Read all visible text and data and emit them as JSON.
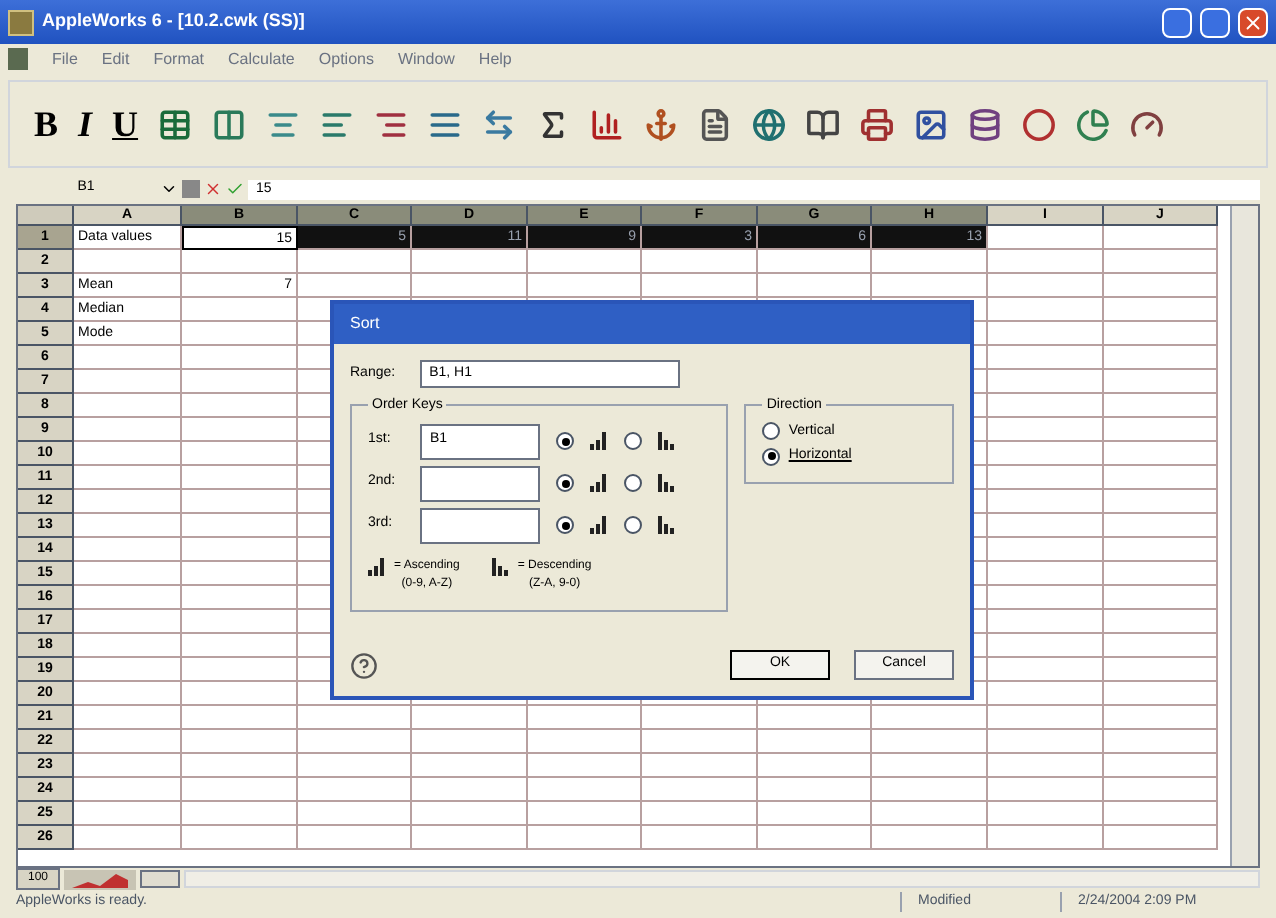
{
  "window": {
    "title": "AppleWorks 6 - [10.2.cwk (SS)]"
  },
  "menu": [
    "File",
    "Edit",
    "Format",
    "Calculate",
    "Options",
    "Window",
    "Help"
  ],
  "toolbar": {
    "text_buttons": [
      "B",
      "I",
      "U"
    ]
  },
  "formula_bar": {
    "cell_ref": "B1",
    "value": "15"
  },
  "columns": [
    {
      "label": "A",
      "selected": false
    },
    {
      "label": "B",
      "selected": true
    },
    {
      "label": "C",
      "selected": true
    },
    {
      "label": "D",
      "selected": true
    },
    {
      "label": "E",
      "selected": true
    },
    {
      "label": "F",
      "selected": true
    },
    {
      "label": "G",
      "selected": true
    },
    {
      "label": "H",
      "selected": true
    },
    {
      "label": "I",
      "selected": false
    },
    {
      "label": "J",
      "selected": false
    }
  ],
  "rows": [
    {
      "number": "1",
      "selected": true,
      "cells": [
        "Data values",
        "15",
        "5",
        "11",
        "9",
        "3",
        "6",
        "13"
      ]
    },
    {
      "number": "2",
      "selected": false,
      "cells": []
    },
    {
      "number": "3",
      "selected": false,
      "cells": [
        "Mean",
        "7"
      ]
    },
    {
      "number": "4",
      "selected": false,
      "cells": [
        "Median"
      ]
    },
    {
      "number": "5",
      "selected": false,
      "cells": [
        "Mode"
      ]
    },
    {
      "number": "6",
      "selected": false,
      "cells": []
    },
    {
      "number": "7",
      "selected": false,
      "cells": []
    },
    {
      "number": "8",
      "selected": false,
      "cells": []
    },
    {
      "number": "9",
      "selected": false,
      "cells": []
    },
    {
      "number": "10",
      "selected": false,
      "cells": []
    },
    {
      "number": "11",
      "selected": false,
      "cells": []
    },
    {
      "number": "12",
      "selected": false,
      "cells": []
    },
    {
      "number": "13",
      "selected": false,
      "cells": []
    },
    {
      "number": "14",
      "selected": false,
      "cells": []
    },
    {
      "number": "15",
      "selected": false,
      "cells": []
    },
    {
      "number": "16",
      "selected": false,
      "cells": []
    },
    {
      "number": "17",
      "selected": false,
      "cells": []
    },
    {
      "number": "18",
      "selected": false,
      "cells": []
    },
    {
      "number": "19",
      "selected": false,
      "cells": []
    },
    {
      "number": "20",
      "selected": false,
      "cells": []
    },
    {
      "number": "21",
      "selected": false,
      "cells": []
    },
    {
      "number": "22",
      "selected": false,
      "cells": []
    },
    {
      "number": "23",
      "selected": false,
      "cells": []
    },
    {
      "number": "24",
      "selected": false,
      "cells": []
    },
    {
      "number": "25",
      "selected": false,
      "cells": []
    },
    {
      "number": "26",
      "selected": false,
      "cells": []
    }
  ],
  "dialog": {
    "title": "Sort",
    "range_label": "Range:",
    "range_value": "B1, H1",
    "order_keys_label": "Order Keys",
    "keys": [
      {
        "label": "1st:",
        "value": "B1",
        "ascending": true
      },
      {
        "label": "2nd:",
        "ascending": true
      },
      {
        "label": "3rd:",
        "ascending": true
      }
    ],
    "ascending_legend": [
      "= Ascending",
      "(0-9, A-Z)"
    ],
    "descending_legend": [
      "= Descending",
      "(Z-A, 9-0)"
    ],
    "direction_label": "Direction",
    "directions": [
      {
        "label": "Vertical",
        "selected": false
      },
      {
        "label": "Horizontal",
        "selected": true
      }
    ],
    "buttons": [
      "OK",
      "Cancel"
    ]
  },
  "zoom": "100",
  "status_bar": {
    "message": "AppleWorks is ready.",
    "state": "Modified",
    "datetime": "2/24/2004 2:09 PM"
  }
}
